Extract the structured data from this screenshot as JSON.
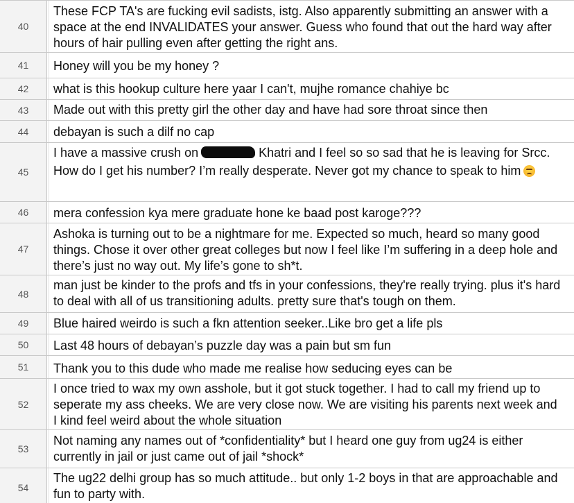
{
  "rows": [
    {
      "num": "40",
      "text": "These FCP TA's are fucking evil sadists, istg. Also apparently submitting an answer with a space at the end INVALIDATES your answer. Guess who found that out the hard way after hours of hair pulling even after getting the right ans."
    },
    {
      "num": "41",
      "text": "Honey will you be my honey ?"
    },
    {
      "num": "42",
      "text": "what is this hookup culture here yaar I can't, mujhe romance chahiye bc"
    },
    {
      "num": "43",
      "text": "Made out with this pretty girl the other day and have had sore throat since then"
    },
    {
      "num": "44",
      "text": "debayan is such a dilf no cap"
    },
    {
      "num": "45",
      "text_before": "I have a massive crush on",
      "text_after": " Khatri and I feel so so sad that he is leaving for Srcc. How do I get his number? I’m really desperate. Never got my chance to speak to him",
      "emoji": "persevering-face-emoji"
    },
    {
      "num": "46",
      "text": "mera confession kya mere graduate hone ke baad post karoge???"
    },
    {
      "num": "47",
      "text": "Ashoka is turning out to be a nightmare for me. Expected so much, heard so many good things. Chose it over other great colleges but now I feel like I’m suffering in a deep hole and there’s just no way out. My life’s gone to sh*t."
    },
    {
      "num": "48",
      "text": "man just be kinder to the profs and tfs in your confessions, they're really trying. plus it's hard to deal with all of us transitioning adults. pretty sure that's tough on them."
    },
    {
      "num": "49",
      "text": "Blue haired weirdo is such a fkn attention seeker..Like bro get a life pls"
    },
    {
      "num": "50",
      "text": "Last 48 hours of debayan’s puzzle day was a pain but sm fun"
    },
    {
      "num": "51",
      "text": "Thank you to this dude who made me realise how seducing eyes can be"
    },
    {
      "num": "52",
      "text": "I once tried to wax my own asshole, but it got stuck together. I had to call my friend up to seperate my ass cheeks. We are very close now. We are visiting his parents next week and I kind feel weird about the whole situation"
    },
    {
      "num": "53",
      "text": "Not naming any names out of *confidentiality* but I heard one guy from ug24 is either currently in jail or just came out of jail *shock*"
    },
    {
      "num": "54",
      "text": "The ug22 delhi group has so much attitude.. but only 1-2 boys in that are approachable and fun to party with."
    }
  ]
}
